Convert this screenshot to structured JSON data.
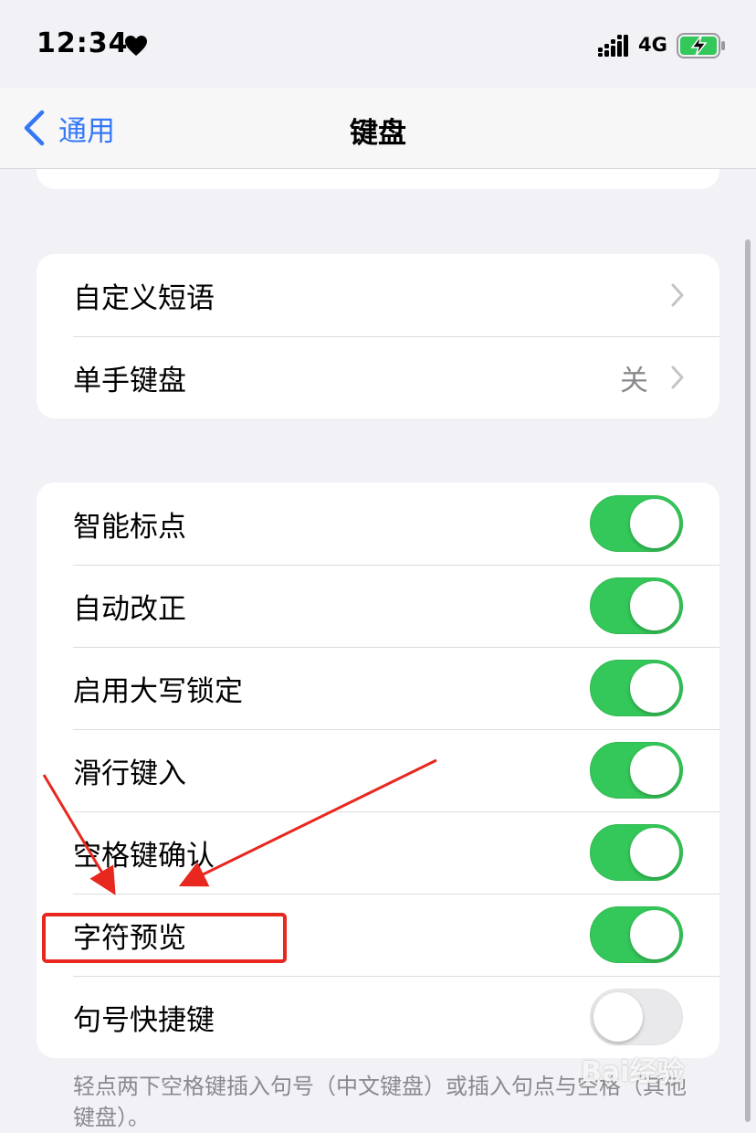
{
  "status_bar": {
    "time": "12:34",
    "network": "4G",
    "icons": [
      "heart-icon",
      "signal-icon",
      "battery-charging-icon"
    ]
  },
  "nav": {
    "back_label": "通用",
    "title": "键盘"
  },
  "group_1": {
    "items": [
      {
        "label": "自定义短语",
        "value": ""
      },
      {
        "label": "单手键盘",
        "value": "关"
      }
    ]
  },
  "group_2": {
    "items": [
      {
        "label": "智能标点",
        "on": true
      },
      {
        "label": "自动改正",
        "on": true
      },
      {
        "label": "启用大写锁定",
        "on": true
      },
      {
        "label": "滑行键入",
        "on": true
      },
      {
        "label": "空格键确认",
        "on": true
      },
      {
        "label": "字符预览",
        "on": true
      },
      {
        "label": "句号快捷键",
        "on": false
      }
    ]
  },
  "footer": {
    "note": "轻点两下空格键插入句号（中文键盘）或插入句点与空格（其他键盘）。"
  },
  "colors": {
    "accent": "#3478f6",
    "toggle_on": "#34c759",
    "annotation": "#e8281e"
  },
  "watermark": "Bai经验"
}
